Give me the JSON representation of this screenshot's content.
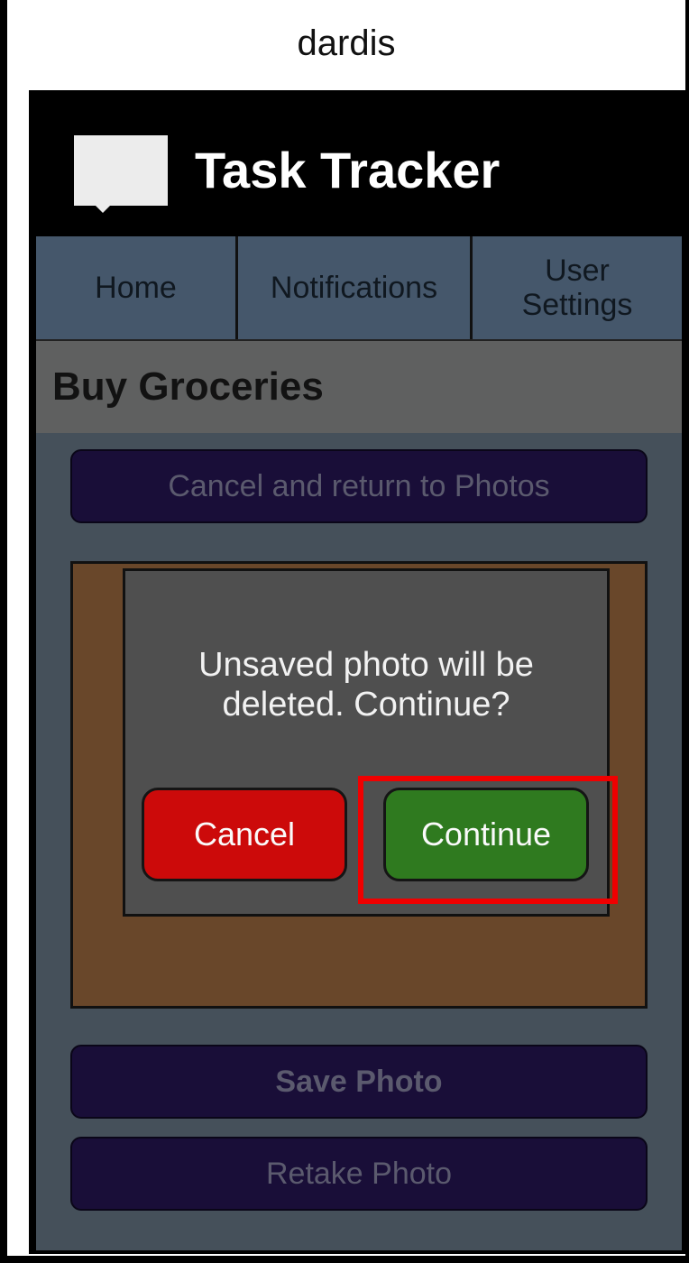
{
  "window": {
    "title": "dardis"
  },
  "header": {
    "logo_icon": "speech-bubble-logo",
    "app_title": "Task Tracker"
  },
  "nav": {
    "tabs": [
      {
        "label": "Home"
      },
      {
        "label": "Notifications"
      },
      {
        "label": "User\nSettings"
      }
    ]
  },
  "page": {
    "title": "Buy Groceries"
  },
  "actions": {
    "cancel_return_label": "Cancel and return to Photos",
    "save_label": "Save Photo",
    "retake_label": "Retake Photo"
  },
  "dialog": {
    "message": "Unsaved photo will be\ndeleted.  Continue?",
    "cancel_label": "Cancel",
    "continue_label": "Continue"
  },
  "colors": {
    "cancel_button": "#cc0a0a",
    "continue_button": "#2f7a1f",
    "highlight": "#f00000",
    "nav_background": "#45576b",
    "action_button": "#190e38"
  }
}
